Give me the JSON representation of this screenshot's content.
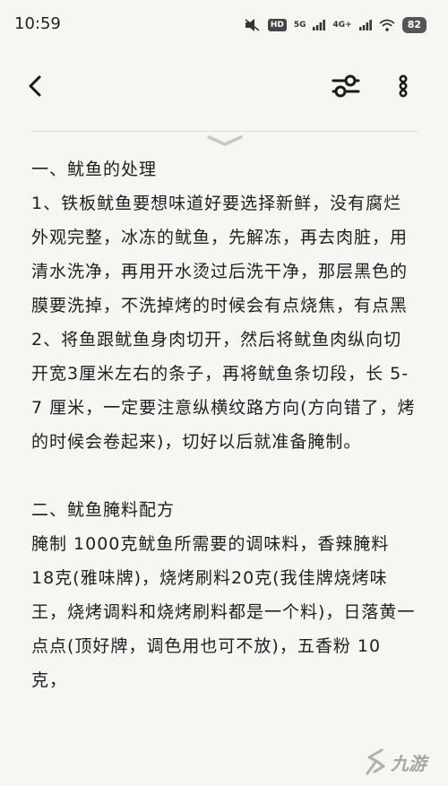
{
  "status_bar": {
    "time": "10:59",
    "hd_label": "HD",
    "net_1": "5G",
    "net_2": "4G+",
    "battery": "82"
  },
  "toolbar": {
    "back_icon": "chevron-left-icon",
    "settings_icon": "sliders-icon",
    "more_icon": "more-vertical-icon"
  },
  "article": {
    "paragraphs": [
      "一、鱿鱼的处理",
      "1、铁板鱿鱼要想味道好要选择新鲜，没有腐烂外观完整，冰冻的鱿鱼，先解冻，再去肉脏，用清水洗净，再用开水烫过后洗干净，那层黑色的膜要洗掉，不洗掉烤的时候会有点烧焦，有点黑",
      "2、将鱼跟鱿鱼身肉切开，然后将鱿鱼肉纵向切开宽3厘米左右的条子，再将鱿鱼条切段，长 5-7 厘米，一定要注意纵横纹路方向(方向错了，烤的时候会卷起来)，切好以后就准备腌制。",
      "二、鱿鱼腌料配方",
      "腌制 1000克鱿鱼所需要的调味料，香辣腌料 18克(雅味牌)，烧烤刷料20克(我佳牌烧烤味王，烧烤调料和烧烤刷料都是一个料)，日落黄一点点(顶好牌，调色用也可不放)，五香粉 10 克，"
    ]
  },
  "watermark": {
    "text": "九游"
  }
}
